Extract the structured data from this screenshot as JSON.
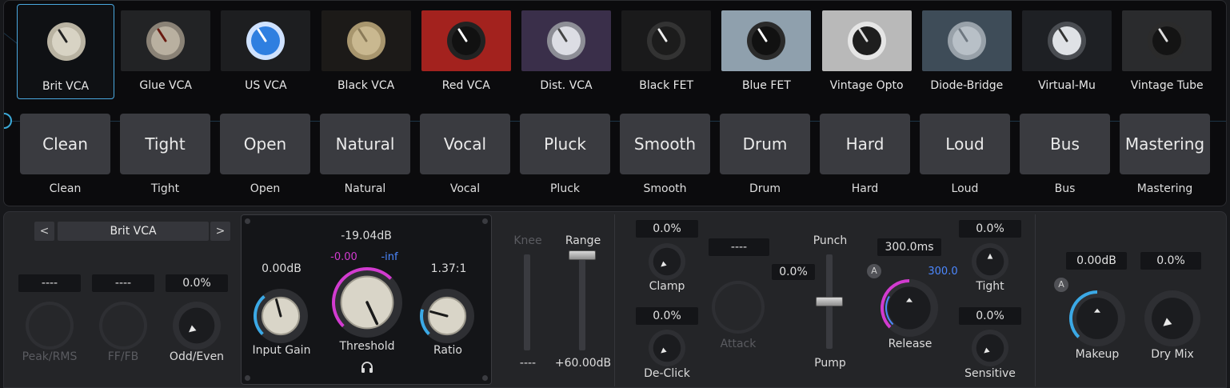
{
  "models": [
    {
      "label": "Brit VCA",
      "selected": true
    },
    {
      "label": "Glue VCA"
    },
    {
      "label": "US VCA"
    },
    {
      "label": "Black VCA"
    },
    {
      "label": "Red VCA"
    },
    {
      "label": "Dist. VCA"
    },
    {
      "label": "Black FET"
    },
    {
      "label": "Blue FET"
    },
    {
      "label": "Vintage Opto"
    },
    {
      "label": "Diode-Bridge"
    },
    {
      "label": "Virtual-Mu"
    },
    {
      "label": "Vintage Tube"
    }
  ],
  "presets": [
    {
      "button": "Clean",
      "label": "Clean"
    },
    {
      "button": "Tight",
      "label": "Tight"
    },
    {
      "button": "Open",
      "label": "Open"
    },
    {
      "button": "Natural",
      "label": "Natural"
    },
    {
      "button": "Vocal",
      "label": "Vocal"
    },
    {
      "button": "Pluck",
      "label": "Pluck"
    },
    {
      "button": "Smooth",
      "label": "Smooth"
    },
    {
      "button": "Drum",
      "label": "Drum"
    },
    {
      "button": "Hard",
      "label": "Hard"
    },
    {
      "button": "Loud",
      "label": "Loud"
    },
    {
      "button": "Bus",
      "label": "Bus"
    },
    {
      "button": "Mastering",
      "label": "Mastering"
    }
  ],
  "nav": {
    "prev": "<",
    "next": ">",
    "current_model": "Brit VCA"
  },
  "detector": {
    "peak_rms": {
      "label": "Peak/RMS",
      "value": "----"
    },
    "ff_fb": {
      "label": "FF/FB",
      "value": "----"
    },
    "odd_even": {
      "label": "Odd/Even",
      "value": "0.0%"
    }
  },
  "main": {
    "threshold_readout": "-19.04dB",
    "threshold_label": "Threshold",
    "meter_in": "-0.00",
    "meter_out": "-inf",
    "input_gain": {
      "label": "Input Gain",
      "value": "0.00dB"
    },
    "ratio": {
      "label": "Ratio",
      "value": "1.37:1"
    },
    "headphone_icon": "headphones-icon"
  },
  "knee_range": {
    "knee_label": "Knee",
    "knee_value": "----",
    "range_label": "Range",
    "range_value": "+60.00dB"
  },
  "timing": {
    "clamp": {
      "label": "Clamp",
      "value": "0.0%"
    },
    "declick": {
      "label": "De-Click",
      "value": "0.0%"
    },
    "attack": {
      "label": "Attack",
      "value": "----"
    },
    "punch_label": "Punch",
    "pump_label": "Pump",
    "punch_pump_value": "0.0%",
    "release": {
      "label": "Release",
      "value": "300.0ms",
      "auto_value": "300.0"
    },
    "tight": {
      "label": "Tight",
      "value": "0.0%"
    },
    "sensitive": {
      "label": "Sensitive",
      "value": "0.0%"
    },
    "auto_badge": "A"
  },
  "output": {
    "makeup": {
      "label": "Makeup",
      "value": "0.00dB"
    },
    "dry_mix": {
      "label": "Dry Mix",
      "value": "0.0%"
    },
    "auto_badge": "A"
  },
  "colors": {
    "accent_blue": "#3ba9e6",
    "accent_magenta": "#d23bd0",
    "selected_border": "#4aa8e0",
    "auto_blue_text": "#4c88ff"
  }
}
